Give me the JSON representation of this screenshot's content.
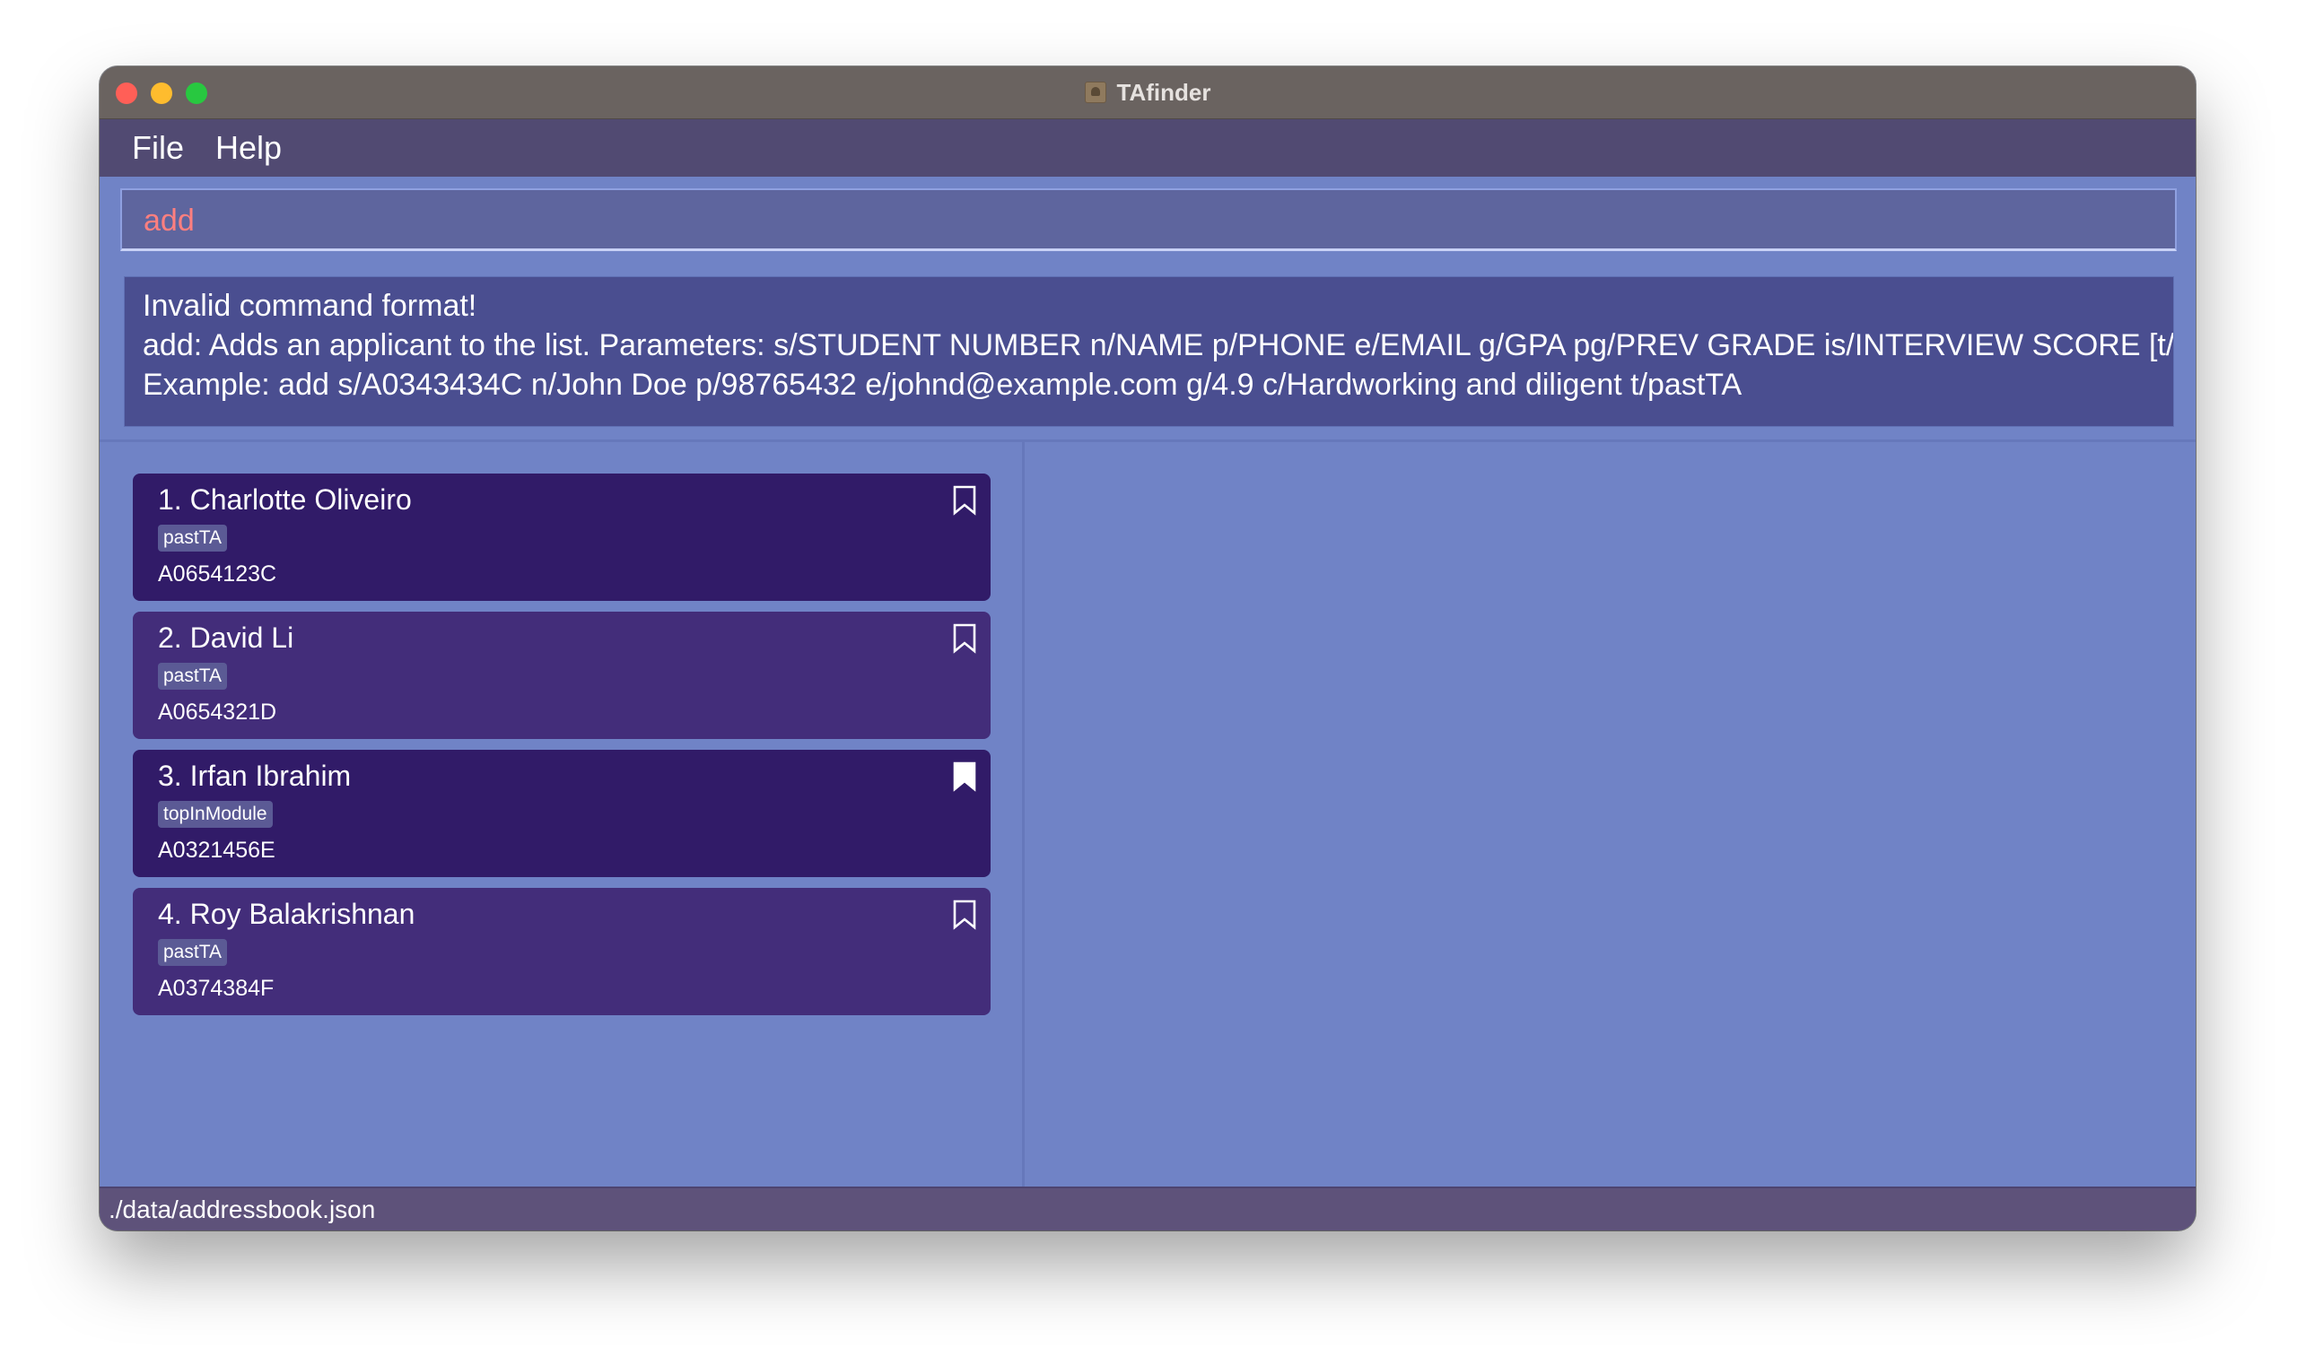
{
  "window": {
    "title": "TAfinder"
  },
  "menu": {
    "file": "File",
    "help": "Help"
  },
  "command": {
    "value": "add"
  },
  "result": {
    "line1": "Invalid command format!",
    "line2": "add: Adds an applicant to the list. Parameters: s/STUDENT NUMBER n/NAME p/PHONE e/EMAIL g/GPA pg/PREV GRADE is/INTERVIEW SCORE [t/TAG]...",
    "line3": "Example: add s/A0343434C n/John Doe p/98765432 e/johnd@example.com g/4.9 c/Hardworking and diligent t/pastTA"
  },
  "applicants": [
    {
      "name": "1.  Charlotte Oliveiro",
      "tag": "pastTA",
      "id": "A0654123C",
      "bookmarked": false
    },
    {
      "name": "2.  David Li",
      "tag": "pastTA",
      "id": "A0654321D",
      "bookmarked": false
    },
    {
      "name": "3.  Irfan Ibrahim",
      "tag": "topInModule",
      "id": "A0321456E",
      "bookmarked": true
    },
    {
      "name": "4.  Roy Balakrishnan",
      "tag": "pastTA",
      "id": "A0374384F",
      "bookmarked": false
    }
  ],
  "status_bar": {
    "path": "./data/addressbook.json"
  },
  "colors": {
    "background": "#7083c6",
    "card_dark": "#311b68",
    "card_light": "#432d7a",
    "command_text": "#ff7f7f"
  },
  "icons": {
    "bookmark_empty": "bookmark-outline-icon",
    "bookmark_filled": "bookmark-filled-icon"
  }
}
